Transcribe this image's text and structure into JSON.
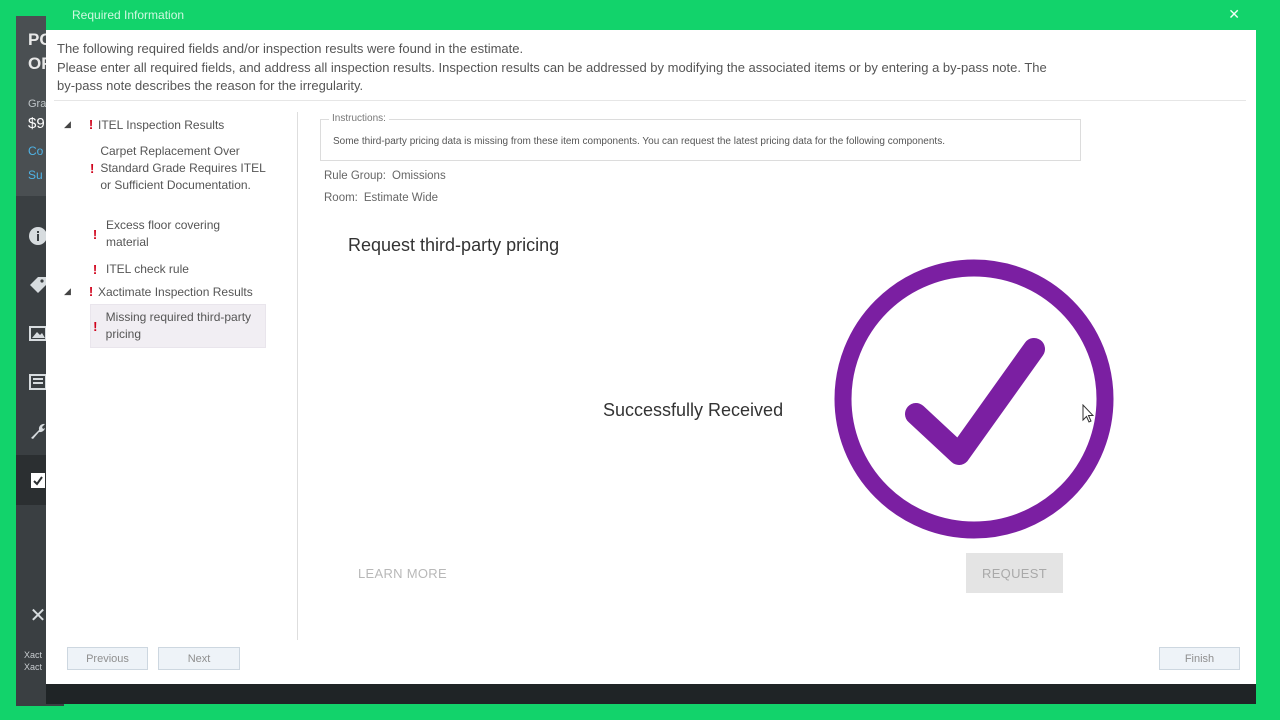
{
  "background_app": {
    "letters": [
      "PC",
      "OF"
    ],
    "gra_label": "Gra",
    "price": "$9",
    "links": [
      "Co",
      "Su"
    ],
    "footer": [
      "Xact",
      "Xact"
    ]
  },
  "dialog": {
    "title": "Required Information",
    "intro_lines": [
      "The following required fields and/or inspection results were found in the estimate.",
      "Please enter all required fields, and address all inspection results. Inspection results can be addressed by modifying the associated items or by entering a by-pass note. The",
      "by-pass note describes the reason for the irregularity."
    ],
    "tree": {
      "groups": [
        {
          "label": "ITEL Inspection Results",
          "children": [
            "Carpet Replacement Over Standard Grade Requires ITEL or Sufficient Documentation.",
            "Excess floor covering material",
            "ITEL check rule"
          ]
        },
        {
          "label": "Xactimate Inspection Results",
          "children": [
            "Missing required third-party pricing"
          ]
        }
      ]
    },
    "instructions": {
      "legend": "Instructions:",
      "text": "Some third-party pricing data is missing from these item components. You can request the latest pricing data for the following components."
    },
    "rule_group": {
      "label": "Rule Group:",
      "value": "Omissions"
    },
    "room": {
      "label": "Room:",
      "value": "Estimate Wide"
    },
    "card_title": "Request third-party pricing",
    "status_text": "Successfully Received",
    "learn_more": "LEARN MORE",
    "request": "REQUEST",
    "buttons": {
      "previous": "Previous",
      "next": "Next",
      "finish": "Finish"
    }
  },
  "colors": {
    "frame": "#12d36b",
    "check_purple": "#7b1fa2",
    "error_red": "#d0021b"
  },
  "icons": [
    "info-icon",
    "tag-icon",
    "image-icon",
    "list-icon",
    "wrench-icon",
    "clipboard-check-icon",
    "close-icon",
    "check-circle-icon"
  ]
}
